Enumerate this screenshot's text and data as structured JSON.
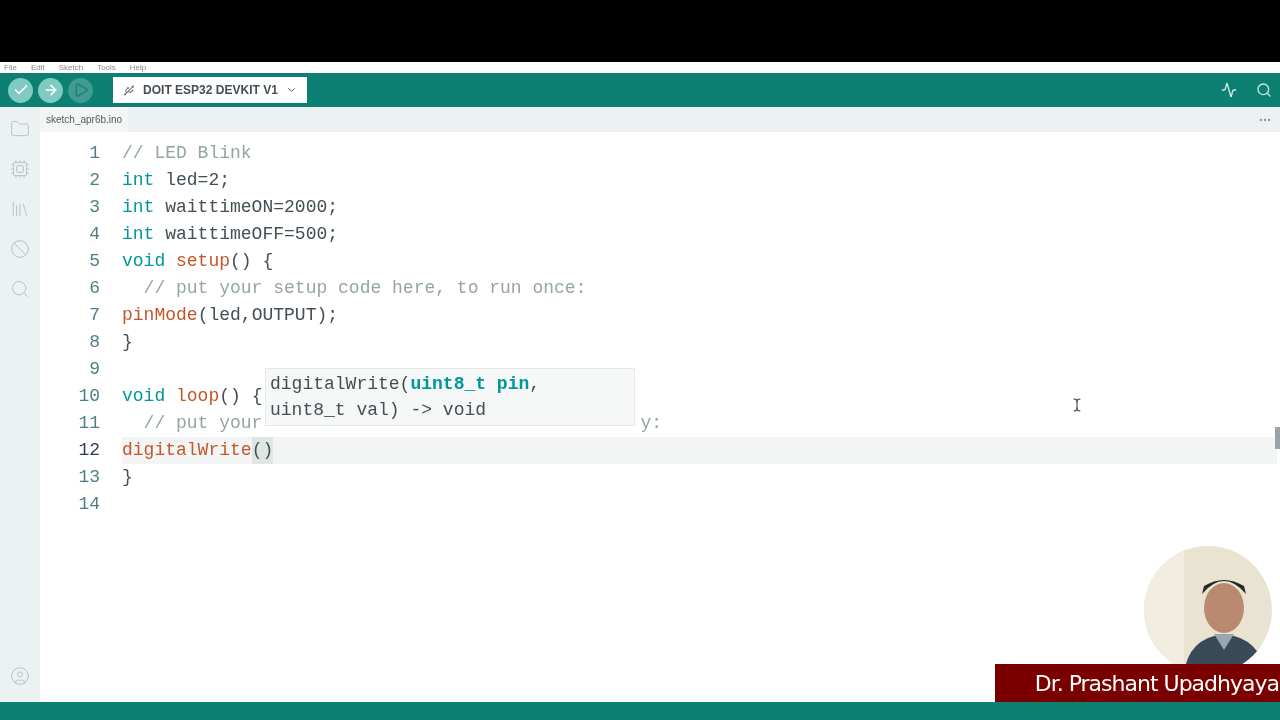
{
  "menu": [
    "File",
    "Edit",
    "Sketch",
    "Tools",
    "Help"
  ],
  "toolbar": {
    "buttons": [
      {
        "kind": "verify",
        "disabled": false
      },
      {
        "kind": "upload",
        "disabled": false
      },
      {
        "kind": "debug",
        "disabled": true
      }
    ],
    "board": "DOIT ESP32 DEVKIT V1"
  },
  "tab": {
    "label": "sketch_apr6b.ino"
  },
  "editor": {
    "lines": [
      {
        "number": "1",
        "current": false,
        "tokens": [
          {
            "text": "// LED Blink",
            "kind": "comment"
          }
        ]
      },
      {
        "number": "2",
        "current": false,
        "tokens": [
          {
            "text": "int",
            "kind": "keyword"
          },
          {
            "text": " led=2;",
            "kind": "plain"
          }
        ]
      },
      {
        "number": "3",
        "current": false,
        "tokens": [
          {
            "text": "int",
            "kind": "keyword"
          },
          {
            "text": " waittimeON=2000;",
            "kind": "plain"
          }
        ]
      },
      {
        "number": "4",
        "current": false,
        "tokens": [
          {
            "text": "int",
            "kind": "keyword"
          },
          {
            "text": " waittimeOFF=500;",
            "kind": "plain"
          }
        ]
      },
      {
        "number": "5",
        "current": false,
        "tokens": [
          {
            "text": "void",
            "kind": "keyword"
          },
          {
            "text": "setup",
            "kind": "function-spaced"
          },
          {
            "text": "() {",
            "kind": "plain"
          }
        ]
      },
      {
        "number": "6",
        "current": false,
        "tokens": [
          {
            "text": "  // put your setup code here, to run once:",
            "kind": "comment"
          }
        ]
      },
      {
        "number": "7",
        "current": false,
        "tokens": [
          {
            "text": "pinMode",
            "kind": "function"
          },
          {
            "text": "(led,OUTPUT);",
            "kind": "plain"
          }
        ]
      },
      {
        "number": "8",
        "current": false,
        "tokens": [
          {
            "text": "}",
            "kind": "plain"
          }
        ]
      },
      {
        "number": "9",
        "current": false
      },
      {
        "number": "10",
        "current": false,
        "tokens": [
          {
            "text": "void",
            "kind": "keyword"
          },
          {
            "text": "loop",
            "kind": "function-spaced"
          },
          {
            "text": "() {",
            "kind": "plain"
          }
        ]
      },
      {
        "number": "11",
        "current": false,
        "tokens": [
          {
            "text": "  // put your",
            "kind": "comment"
          },
          {
            "text": "y:",
            "kind": "comment-after-hidden"
          }
        ]
      },
      {
        "number": "12",
        "current": true,
        "tokens": [
          {
            "text": "digitalWrite",
            "kind": "function"
          },
          {
            "text": "()",
            "kind": "bracket-match"
          }
        ]
      },
      {
        "number": "13",
        "current": false,
        "tokens": [
          {
            "text": "}",
            "kind": "plain"
          }
        ]
      },
      {
        "number": "14",
        "current": false
      }
    ],
    "tooltip": [
      [
        {
          "text": "digitalWrite(",
          "active": false
        },
        {
          "text": "uint8_t pin",
          "active": true
        },
        {
          "text": ",",
          "active": false
        }
      ],
      [
        {
          "text": "uint8_t val) -> void",
          "active": false
        }
      ]
    ]
  },
  "presenter": {
    "name": "Dr. Prashant Upadhyaya"
  }
}
